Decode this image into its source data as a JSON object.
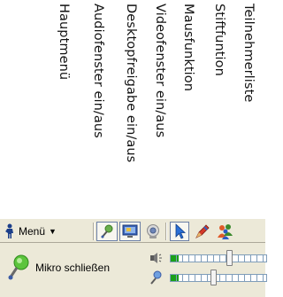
{
  "callouts": [
    {
      "label": "Hauptmenü"
    },
    {
      "label": "Audiofenster ein/aus"
    },
    {
      "label": "Desktopfreigabe ein/aus"
    },
    {
      "label": "Videofenster ein/aus"
    },
    {
      "label": "Mausfunktion"
    },
    {
      "label": "Stiftfuntion"
    },
    {
      "label": "Teilnehmerliste"
    }
  ],
  "toolbar": {
    "menu_label": "Menü",
    "icons": [
      "presenter-icon",
      "audio-window-icon",
      "desktop-share-icon",
      "video-window-icon",
      "mouse-pointer-icon",
      "pen-icon",
      "participants-icon"
    ]
  },
  "audio": {
    "mic_label": "Mikro schließen",
    "speaker_level": 0.08,
    "mic_level": 0.08,
    "speaker_slider": 0.62,
    "mic_slider": 0.45
  },
  "colors": {
    "toolbar_bg": "#ece9d8",
    "pressed_border": "#6b7fa6",
    "meter_green": "#1aa01a"
  }
}
